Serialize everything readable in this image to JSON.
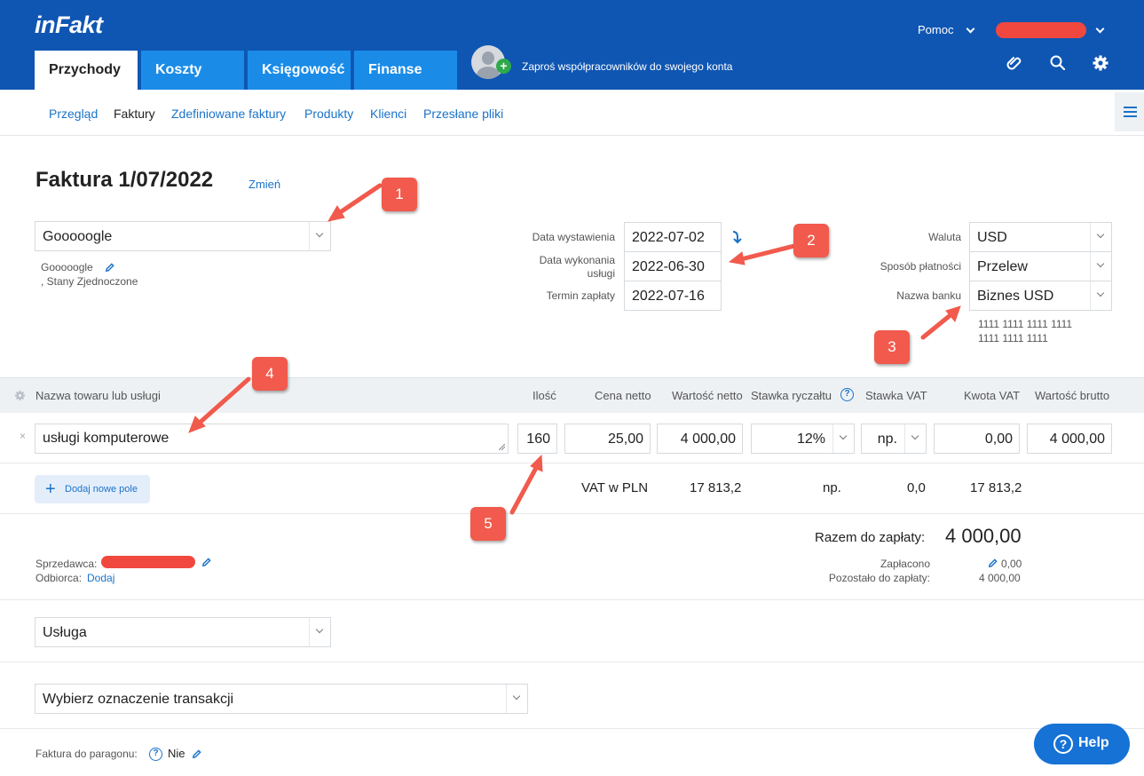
{
  "header": {
    "logo": "inFakt",
    "help_menu": "Pomoc",
    "tabs": [
      "Przychody",
      "Koszty",
      "Księgowość",
      "Finanse"
    ],
    "invite_text": "Zaproś współpracowników do swojego konta"
  },
  "subnav": {
    "items": [
      "Przegląd",
      "Faktury",
      "Zdefiniowane faktury",
      "Produkty",
      "Klienci",
      "Przesłane pliki"
    ],
    "active": "Faktury"
  },
  "invoice": {
    "title": "Faktura 1/07/2022",
    "change_link": "Zmień",
    "client_select": "Gooooogle",
    "client_name": "Gooooogle",
    "client_address": ", Stany Zjednoczone",
    "dates": {
      "issue_label": "Data wystawienia",
      "issue_value": "2022-07-02",
      "service_label_1": "Data wykonania",
      "service_label_2": "usługi",
      "service_value": "2022-06-30",
      "due_label": "Termin zapłaty",
      "due_value": "2022-07-16"
    },
    "payment": {
      "currency_label": "Waluta",
      "currency_value": "USD",
      "method_label": "Sposób płatności",
      "method_value": "Przelew",
      "bank_label": "Nazwa banku",
      "bank_value": "Biznes USD",
      "account_line_1": "1111 1111 1111 1111",
      "account_line_2": "1111 1111 1111"
    }
  },
  "items_table": {
    "headers": {
      "name": "Nazwa towaru lub usługi",
      "qty": "Ilość",
      "net_price": "Cena netto",
      "net_value": "Wartość netto",
      "flat_rate": "Stawka ryczałtu",
      "vat_rate": "Stawka VAT",
      "vat_amount": "Kwota VAT",
      "gross_value": "Wartość brutto"
    },
    "row": {
      "remove": "×",
      "name": "usługi komputerowe",
      "qty": "160",
      "net_price": "25,00",
      "net_value": "4 000,00",
      "flat_rate": "12%",
      "vat_rate": "np.",
      "vat_amount": "0,00",
      "gross_value": "4 000,00"
    },
    "add_field": "Dodaj nowe pole",
    "pln_row": {
      "label": "VAT w PLN",
      "net": "17 813,2",
      "vat_rate": "np.",
      "vat": "0,0",
      "gross": "17 813,2"
    }
  },
  "totals": {
    "total_label": "Razem do zapłaty:",
    "total_value": "4 000,00",
    "paid_label": "Zapłacono",
    "paid_value": "0,00",
    "remaining_label": "Pozostało do zapłaty:",
    "remaining_value": "4 000,00"
  },
  "parties": {
    "seller_label": "Sprzedawca:",
    "buyer_label": "Odbiorca:",
    "buyer_link": "Dodaj"
  },
  "selects": {
    "kind": "Usługa",
    "transaction": "Wybierz oznaczenie transakcji"
  },
  "receipt": {
    "label": "Faktura do paragonu:",
    "value": "Nie"
  },
  "help_button": "Help",
  "annotations": [
    "1",
    "2",
    "3",
    "4",
    "5"
  ],
  "colors": {
    "brand_blue": "#0f56b3",
    "tab_blue": "#1a8ce8",
    "link_blue": "#1a73c9",
    "annotation_red": "#f15a4c",
    "redaction_red": "#f0483e"
  }
}
